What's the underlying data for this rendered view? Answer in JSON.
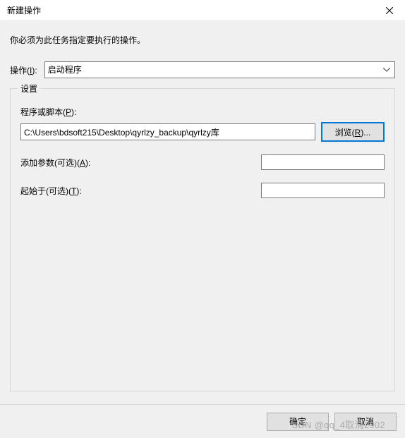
{
  "titlebar": {
    "title": "新建操作"
  },
  "instruction": "你必须为此任务指定要执行的操作。",
  "action": {
    "label_prefix": "操作(",
    "label_hotkey": "I",
    "label_suffix": "):",
    "selected": "启动程序"
  },
  "settings": {
    "legend": "设置",
    "program": {
      "label_prefix": "程序或脚本(",
      "label_hotkey": "P",
      "label_suffix": "):",
      "value": "C:\\Users\\bdsoft215\\Desktop\\qyrlzy_backup\\qyrlzy库",
      "browse_prefix": "浏览(",
      "browse_hotkey": "R",
      "browse_suffix": ")..."
    },
    "args": {
      "label_prefix": "添加参数(可选)(",
      "label_hotkey": "A",
      "label_suffix": "):",
      "value": ""
    },
    "startin": {
      "label_prefix": "起始于(可选)(",
      "label_hotkey": "T",
      "label_suffix": "):",
      "value": ""
    }
  },
  "footer": {
    "ok": "确定",
    "cancel": "取消"
  },
  "watermark": "SDN @qq_4取消2902"
}
